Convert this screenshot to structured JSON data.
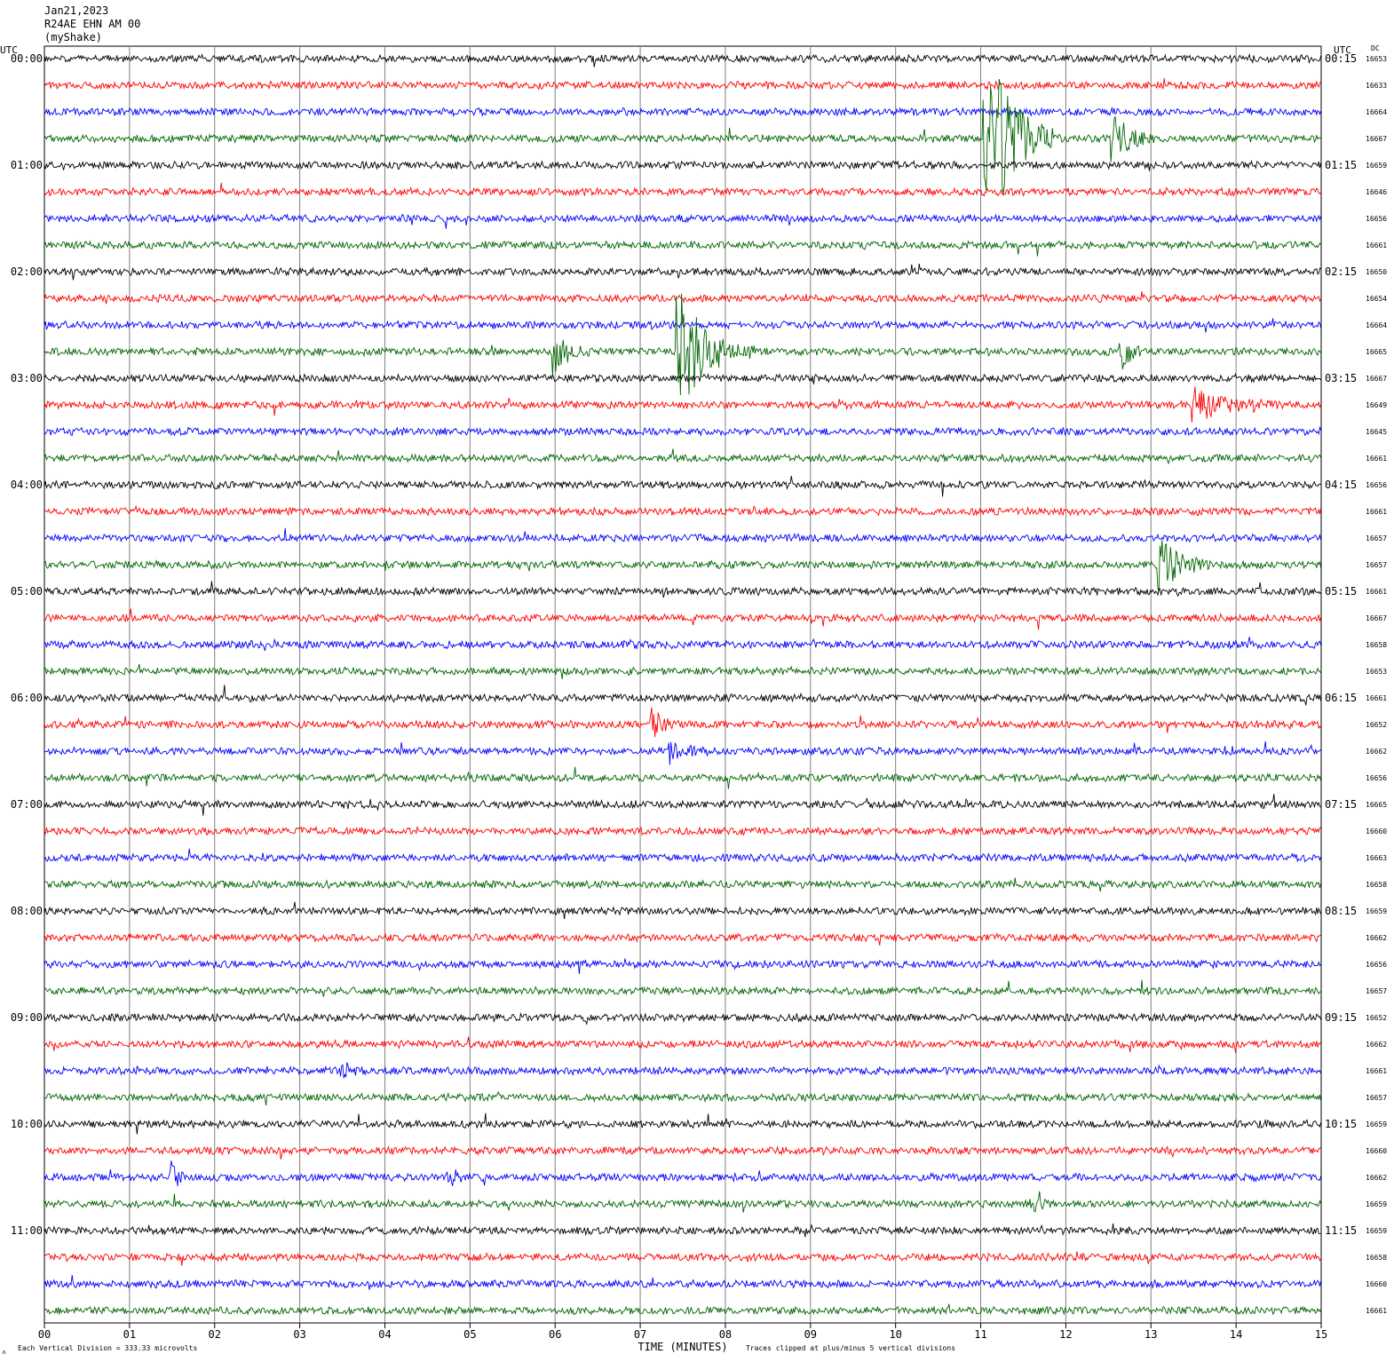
{
  "header": {
    "date": "Jan21,2023",
    "station": "R24AE EHN AM 00",
    "source": "(myShake)"
  },
  "left_axis_title": "UTC",
  "right_axis_title": "UTC",
  "dc_title": "DC",
  "x_axis_title": "TIME (MINUTES)",
  "footer_note_left": "Each Vertical Division =  333.33 microvolts",
  "footer_note_right": "Traces clipped at plus/minus 5 vertical divisions",
  "corner_mark": "˄",
  "colors": {
    "cycle": [
      "#000000",
      "#ff0000",
      "#0000ff",
      "#006400"
    ],
    "grid": "#808080"
  },
  "chart_data": {
    "type": "line",
    "x_ticks": [
      "00",
      "01",
      "02",
      "03",
      "04",
      "05",
      "06",
      "07",
      "08",
      "09",
      "10",
      "11",
      "12",
      "13",
      "14",
      "15"
    ],
    "xlim": [
      0,
      15
    ],
    "left_hour_labels": [
      "00:00",
      "01:00",
      "02:00",
      "03:00",
      "04:00",
      "05:00",
      "06:00",
      "07:00",
      "08:00",
      "09:00",
      "10:00",
      "11:00"
    ],
    "right_hour_labels": [
      "00:15",
      "01:15",
      "02:15",
      "03:15",
      "04:15",
      "05:15",
      "06:15",
      "07:15",
      "08:15",
      "09:15",
      "10:15",
      "11:15"
    ],
    "dc_values": [
      "16653",
      "16633",
      "16664",
      "16667",
      "16659",
      "16646",
      "16656",
      "16661",
      "16650",
      "16654",
      "16664",
      "16665",
      "16667",
      "16649",
      "16645",
      "16661",
      "16656",
      "16661",
      "16657",
      "16657",
      "16661",
      "16667",
      "16658",
      "16653",
      "16661",
      "16652",
      "16662",
      "16656",
      "16665",
      "16660",
      "16663",
      "16658",
      "16659",
      "16662",
      "16656",
      "16657",
      "16652",
      "16662",
      "16661",
      "16657",
      "16659",
      "16660",
      "16662",
      "16659",
      "16659",
      "16658",
      "16660",
      "16661"
    ],
    "events": [
      {
        "trace": 3,
        "minute": 11.05,
        "amplitude": 4.5,
        "duration": 0.8
      },
      {
        "trace": 3,
        "minute": 12.55,
        "amplitude": 1.0,
        "duration": 0.5
      },
      {
        "trace": 11,
        "minute": 7.45,
        "amplitude": 2.3,
        "duration": 0.9
      },
      {
        "trace": 11,
        "minute": 6.0,
        "amplitude": 0.9,
        "duration": 0.4
      },
      {
        "trace": 11,
        "minute": 12.65,
        "amplitude": 0.8,
        "duration": 0.3
      },
      {
        "trace": 13,
        "minute": 13.5,
        "amplitude": 0.6,
        "duration": 1.0
      },
      {
        "trace": 19,
        "minute": 13.1,
        "amplitude": 1.1,
        "duration": 0.6
      },
      {
        "trace": 25,
        "minute": 7.15,
        "amplitude": 0.6,
        "duration": 0.3
      },
      {
        "trace": 26,
        "minute": 7.35,
        "amplitude": 0.4,
        "duration": 0.5
      },
      {
        "trace": 38,
        "minute": 3.5,
        "amplitude": 0.3,
        "duration": 0.3
      },
      {
        "trace": 42,
        "minute": 1.5,
        "amplitude": 0.6,
        "duration": 0.2
      },
      {
        "trace": 42,
        "minute": 4.75,
        "amplitude": 0.6,
        "duration": 0.2
      },
      {
        "trace": 43,
        "minute": 11.6,
        "amplitude": 0.5,
        "duration": 0.2
      }
    ]
  }
}
